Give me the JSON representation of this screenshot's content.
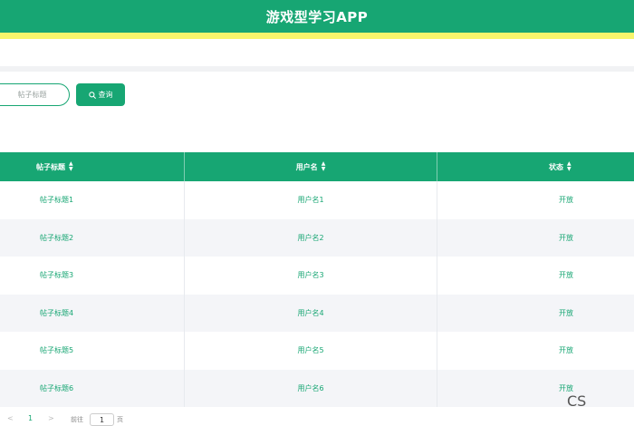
{
  "header": {
    "title": "游戏型学习APP"
  },
  "search": {
    "placeholder": "帖子标题",
    "button_label": "查询"
  },
  "table": {
    "columns": [
      "帖子标题",
      "用户名",
      "状态"
    ],
    "rows": [
      [
        "帖子标题1",
        "用户名1",
        "开放"
      ],
      [
        "帖子标题2",
        "用户名2",
        "开放"
      ],
      [
        "帖子标题3",
        "用户名3",
        "开放"
      ],
      [
        "帖子标题4",
        "用户名4",
        "开放"
      ],
      [
        "帖子标题5",
        "用户名5",
        "开放"
      ],
      [
        "帖子标题6",
        "用户名6",
        "开放"
      ]
    ]
  },
  "pagination": {
    "prev": "<",
    "current": "1",
    "next": ">",
    "goto_label": "前往",
    "goto_value": "1",
    "unit": "页"
  },
  "watermark": "CS",
  "colors": {
    "primary": "#17a673",
    "accent_bar": "#f7f56c",
    "row_alt": "#f4f5f8"
  }
}
